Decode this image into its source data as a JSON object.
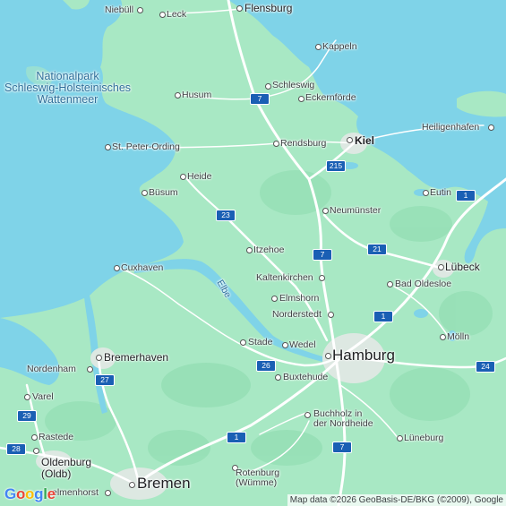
{
  "map": {
    "water_labels": [
      {
        "id": "wattenmeer",
        "text": "Nationalpark\nSchleswig-Holsteinisches\nWattenmeer"
      },
      {
        "id": "elbe",
        "text": "Elbe"
      }
    ],
    "places": {
      "niebuell": "Niebüll",
      "leck": "Leck",
      "flensburg": "Flensburg",
      "kappeln": "Kappeln",
      "husum": "Husum",
      "schleswig": "Schleswig",
      "eckernfoerde": "Eckernförde",
      "heiligenhafen": "Heiligenhafen",
      "st_peter_ording": "St. Peter-Ording",
      "rendsburg": "Rendsburg",
      "kiel": "Kiel",
      "heide": "Heide",
      "buesum": "Büsum",
      "eutin": "Eutin",
      "neumuenster": "Neumünster",
      "itzehoe": "Itzehoe",
      "cuxhaven": "Cuxhaven",
      "luebeck": "Lübeck",
      "kaltenkirchen": "Kaltenkirchen",
      "bad_oldesloe": "Bad Oldesloe",
      "elmshorn": "Elmshorn",
      "norderstedt": "Norderstedt",
      "moelln": "Mölln",
      "stade": "Stade",
      "wedel": "Wedel",
      "hamburg": "Hamburg",
      "nordenham": "Nordenham",
      "bremerhaven": "Bremerhaven",
      "buxtehude": "Buxtehude",
      "varel": "Varel",
      "buchholz": "Buchholz in\nder Nordheide",
      "rastede": "Rastede",
      "lueneburg": "Lüneburg",
      "oldenburg": "Oldenburg\n(Oldb)",
      "rotenburg": "Rotenburg\n(Wümme)",
      "delmenhorst": "elmenhorst",
      "bremen": "Bremen"
    },
    "route_shields": [
      "7",
      "215",
      "1",
      "23",
      "21",
      "7",
      "1",
      "26",
      "27",
      "29",
      "24",
      "1",
      "7",
      "28"
    ],
    "attribution": "Map data ©2026 GeoBasis-DE/BKG (©2009), Google",
    "logo": "Google",
    "colors": {
      "land": "#a8e8c4",
      "water": "#7fd3e8",
      "road": "#ffffff",
      "shield": "#1a5fb4",
      "urban": "#d9e6e0"
    }
  }
}
